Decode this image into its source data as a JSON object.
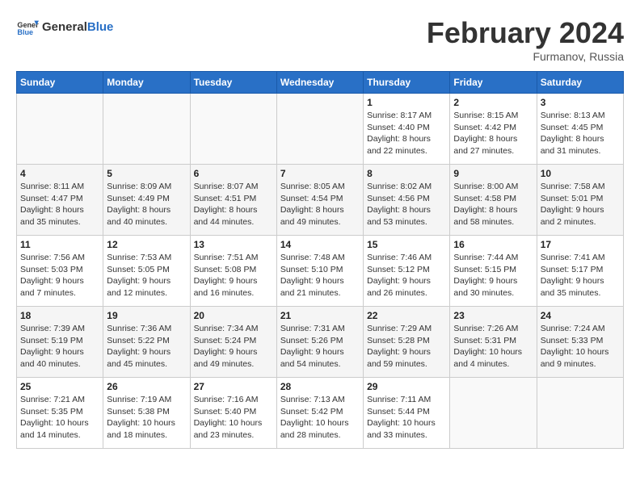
{
  "header": {
    "logo_general": "General",
    "logo_blue": "Blue",
    "month": "February 2024",
    "location": "Furmanov, Russia"
  },
  "days_of_week": [
    "Sunday",
    "Monday",
    "Tuesday",
    "Wednesday",
    "Thursday",
    "Friday",
    "Saturday"
  ],
  "weeks": [
    [
      {
        "day": "",
        "info": ""
      },
      {
        "day": "",
        "info": ""
      },
      {
        "day": "",
        "info": ""
      },
      {
        "day": "",
        "info": ""
      },
      {
        "day": "1",
        "info": "Sunrise: 8:17 AM\nSunset: 4:40 PM\nDaylight: 8 hours\nand 22 minutes."
      },
      {
        "day": "2",
        "info": "Sunrise: 8:15 AM\nSunset: 4:42 PM\nDaylight: 8 hours\nand 27 minutes."
      },
      {
        "day": "3",
        "info": "Sunrise: 8:13 AM\nSunset: 4:45 PM\nDaylight: 8 hours\nand 31 minutes."
      }
    ],
    [
      {
        "day": "4",
        "info": "Sunrise: 8:11 AM\nSunset: 4:47 PM\nDaylight: 8 hours\nand 35 minutes."
      },
      {
        "day": "5",
        "info": "Sunrise: 8:09 AM\nSunset: 4:49 PM\nDaylight: 8 hours\nand 40 minutes."
      },
      {
        "day": "6",
        "info": "Sunrise: 8:07 AM\nSunset: 4:51 PM\nDaylight: 8 hours\nand 44 minutes."
      },
      {
        "day": "7",
        "info": "Sunrise: 8:05 AM\nSunset: 4:54 PM\nDaylight: 8 hours\nand 49 minutes."
      },
      {
        "day": "8",
        "info": "Sunrise: 8:02 AM\nSunset: 4:56 PM\nDaylight: 8 hours\nand 53 minutes."
      },
      {
        "day": "9",
        "info": "Sunrise: 8:00 AM\nSunset: 4:58 PM\nDaylight: 8 hours\nand 58 minutes."
      },
      {
        "day": "10",
        "info": "Sunrise: 7:58 AM\nSunset: 5:01 PM\nDaylight: 9 hours\nand 2 minutes."
      }
    ],
    [
      {
        "day": "11",
        "info": "Sunrise: 7:56 AM\nSunset: 5:03 PM\nDaylight: 9 hours\nand 7 minutes."
      },
      {
        "day": "12",
        "info": "Sunrise: 7:53 AM\nSunset: 5:05 PM\nDaylight: 9 hours\nand 12 minutes."
      },
      {
        "day": "13",
        "info": "Sunrise: 7:51 AM\nSunset: 5:08 PM\nDaylight: 9 hours\nand 16 minutes."
      },
      {
        "day": "14",
        "info": "Sunrise: 7:48 AM\nSunset: 5:10 PM\nDaylight: 9 hours\nand 21 minutes."
      },
      {
        "day": "15",
        "info": "Sunrise: 7:46 AM\nSunset: 5:12 PM\nDaylight: 9 hours\nand 26 minutes."
      },
      {
        "day": "16",
        "info": "Sunrise: 7:44 AM\nSunset: 5:15 PM\nDaylight: 9 hours\nand 30 minutes."
      },
      {
        "day": "17",
        "info": "Sunrise: 7:41 AM\nSunset: 5:17 PM\nDaylight: 9 hours\nand 35 minutes."
      }
    ],
    [
      {
        "day": "18",
        "info": "Sunrise: 7:39 AM\nSunset: 5:19 PM\nDaylight: 9 hours\nand 40 minutes."
      },
      {
        "day": "19",
        "info": "Sunrise: 7:36 AM\nSunset: 5:22 PM\nDaylight: 9 hours\nand 45 minutes."
      },
      {
        "day": "20",
        "info": "Sunrise: 7:34 AM\nSunset: 5:24 PM\nDaylight: 9 hours\nand 49 minutes."
      },
      {
        "day": "21",
        "info": "Sunrise: 7:31 AM\nSunset: 5:26 PM\nDaylight: 9 hours\nand 54 minutes."
      },
      {
        "day": "22",
        "info": "Sunrise: 7:29 AM\nSunset: 5:28 PM\nDaylight: 9 hours\nand 59 minutes."
      },
      {
        "day": "23",
        "info": "Sunrise: 7:26 AM\nSunset: 5:31 PM\nDaylight: 10 hours\nand 4 minutes."
      },
      {
        "day": "24",
        "info": "Sunrise: 7:24 AM\nSunset: 5:33 PM\nDaylight: 10 hours\nand 9 minutes."
      }
    ],
    [
      {
        "day": "25",
        "info": "Sunrise: 7:21 AM\nSunset: 5:35 PM\nDaylight: 10 hours\nand 14 minutes."
      },
      {
        "day": "26",
        "info": "Sunrise: 7:19 AM\nSunset: 5:38 PM\nDaylight: 10 hours\nand 18 minutes."
      },
      {
        "day": "27",
        "info": "Sunrise: 7:16 AM\nSunset: 5:40 PM\nDaylight: 10 hours\nand 23 minutes."
      },
      {
        "day": "28",
        "info": "Sunrise: 7:13 AM\nSunset: 5:42 PM\nDaylight: 10 hours\nand 28 minutes."
      },
      {
        "day": "29",
        "info": "Sunrise: 7:11 AM\nSunset: 5:44 PM\nDaylight: 10 hours\nand 33 minutes."
      },
      {
        "day": "",
        "info": ""
      },
      {
        "day": "",
        "info": ""
      }
    ]
  ]
}
